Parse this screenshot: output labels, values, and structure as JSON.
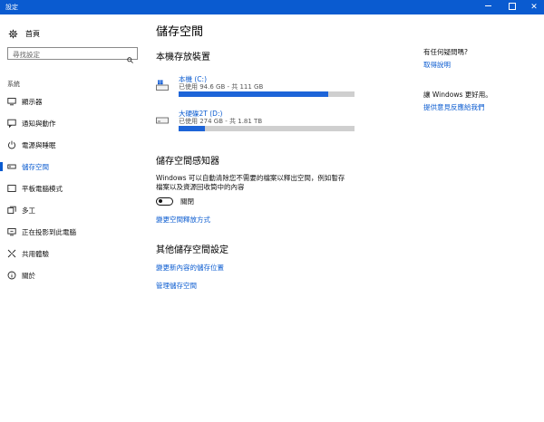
{
  "window": {
    "title": "設定",
    "minimize_glyph": "",
    "close_glyph": "✕"
  },
  "nav": {
    "home_label": "首頁",
    "search_placeholder": "尋找設定",
    "section_label": "系統",
    "items": [
      {
        "label": "顯示器",
        "icon": "monitor-icon"
      },
      {
        "label": "通知與動作",
        "icon": "notification-icon"
      },
      {
        "label": "電源與睡眠",
        "icon": "power-icon"
      },
      {
        "label": "儲存空間",
        "icon": "storage-icon",
        "active": true
      },
      {
        "label": "平板電腦模式",
        "icon": "tablet-icon"
      },
      {
        "label": "多工",
        "icon": "multitasking-icon"
      },
      {
        "label": "正在投影到此電腦",
        "icon": "projecting-icon"
      },
      {
        "label": "共用體驗",
        "icon": "shared-experience-icon"
      },
      {
        "label": "關於",
        "icon": "info-icon"
      }
    ]
  },
  "main": {
    "title": "儲存空間",
    "local_storage_heading": "本機存放裝置",
    "drives": [
      {
        "name": "本機 (C:)",
        "usage": "已使用 94.6 GB - 共 111 GB",
        "used_fraction": 0.852
      },
      {
        "name": "大硬碟2T (D:)",
        "usage": "已使用 274 GB - 共 1.81 TB",
        "used_fraction": 0.148
      }
    ],
    "sense_heading": "儲存空間感知器",
    "sense_description": "Windows 可以自動清除您不需要的檔案以釋出空間，例如暫存檔案以及資源回收筒中的內容",
    "toggle_label": "關閉",
    "change_free_space_link": "變更空間釋放方式",
    "more_heading": "其他儲存空間設定",
    "change_save_location_link": "變更新內容的儲存位置",
    "manage_spaces_link": "管理儲存空間"
  },
  "right": {
    "question_heading": "有任何疑問嗎?",
    "help_link": "取得說明",
    "improve_heading": "讓 Windows 更好用。",
    "feedback_link": "提供意見反應給我們"
  },
  "colors": {
    "accent": "#0a5bd0",
    "bar_fill": "#1d64d8",
    "bar_track": "#cfcfcf"
  }
}
